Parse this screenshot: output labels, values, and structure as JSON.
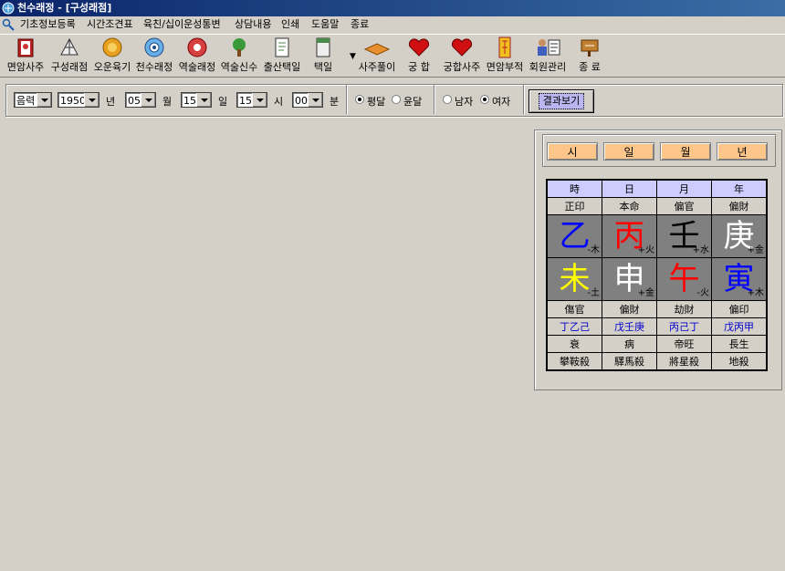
{
  "window": {
    "title": "천수래정 - [구성래점]"
  },
  "menu": [
    "기초정보등록",
    "시간조견표",
    "육친/십이운성통변",
    "상담내용",
    "인쇄",
    "도움말",
    "종료"
  ],
  "toolbar": {
    "items": [
      {
        "label": "면암사주",
        "icon": "book-icon"
      },
      {
        "label": "구성래점",
        "icon": "fan-icon"
      },
      {
        "label": "오운육기",
        "icon": "coin-icon"
      },
      {
        "label": "천수래정",
        "icon": "compass-icon"
      },
      {
        "label": "역술래정",
        "icon": "flower-icon"
      },
      {
        "label": "역술신수",
        "icon": "tree-icon"
      },
      {
        "label": "출산택일",
        "icon": "document-icon"
      },
      {
        "label": "택일",
        "icon": "calendar-icon"
      },
      {
        "label": "사주풀이",
        "icon": "book-open-icon"
      },
      {
        "label": "궁 합",
        "icon": "heart-icon"
      },
      {
        "label": "궁합사주",
        "icon": "heart-icon"
      },
      {
        "label": "면암부적",
        "icon": "talisman-icon"
      },
      {
        "label": "회원관리",
        "icon": "members-icon"
      },
      {
        "label": "종 료",
        "icon": "exit-sign-icon"
      }
    ]
  },
  "options": {
    "calendar_type": "음력",
    "year": "1950",
    "year_unit": "년",
    "month": "05",
    "month_unit": "월",
    "day": "15",
    "day_unit": "일",
    "hour": "15",
    "hour_unit": "시",
    "minute": "00",
    "minute_unit": "분",
    "leap_normal": "평달",
    "leap_month": "윤달",
    "leap_selected": "평달",
    "male": "남자",
    "female": "여자",
    "gender_selected": "여자",
    "result_button": "결과보기"
  },
  "pillar_buttons": [
    "시",
    "일",
    "월",
    "년"
  ],
  "saju_table": {
    "headers": [
      "時",
      "日",
      "月",
      "年"
    ],
    "stem_gods": [
      "正印",
      "本命",
      "偏官",
      "偏財"
    ],
    "stems": [
      {
        "char": "乙",
        "element": "-木",
        "color": "#0000ff"
      },
      {
        "char": "丙",
        "element": "+火",
        "color": "#ff0000"
      },
      {
        "char": "壬",
        "element": "+水",
        "color": "#000000"
      },
      {
        "char": "庚",
        "element": "+金",
        "color": "#ffffff"
      }
    ],
    "branches": [
      {
        "char": "未",
        "element": "-土",
        "color": "#ffff00"
      },
      {
        "char": "申",
        "element": "+金",
        "color": "#ffffff"
      },
      {
        "char": "午",
        "element": "-火",
        "color": "#ff0000"
      },
      {
        "char": "寅",
        "element": "+木",
        "color": "#0000ff"
      }
    ],
    "branch_gods": [
      "傷官",
      "偏財",
      "劫財",
      "偏印"
    ],
    "hidden_stems": [
      "丁乙己",
      "戊壬庚",
      "丙己丁",
      "戊丙甲"
    ],
    "twelve_stages": [
      "衰",
      "病",
      "帝旺",
      "長生"
    ],
    "sinsal": [
      "攀鞍殺",
      "驛馬殺",
      "將星殺",
      "地殺"
    ]
  }
}
